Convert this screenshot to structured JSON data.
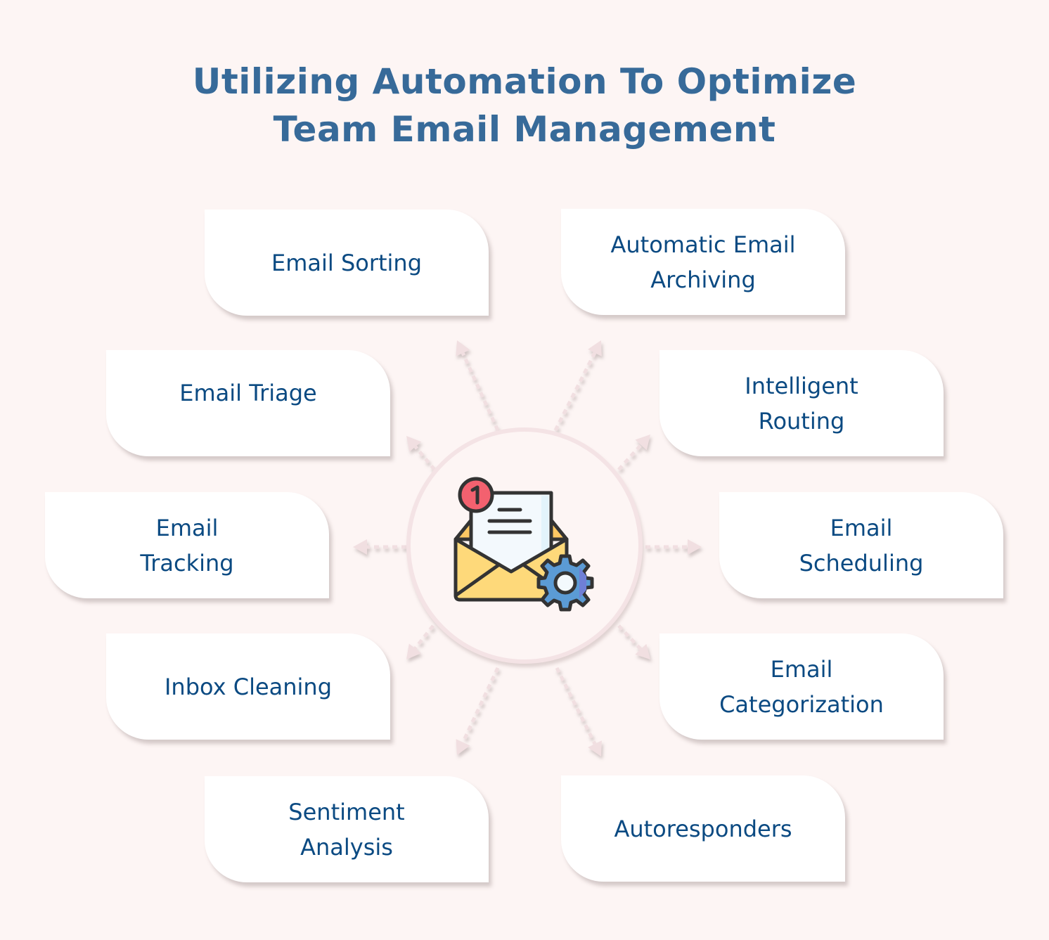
{
  "title": {
    "line1": "Utilizing Automation To Optimize",
    "line2": "Team Email Management"
  },
  "center": {
    "icon": "email-automation-icon",
    "badge_count": "1"
  },
  "colors": {
    "background": "#fdf5f4",
    "title": "#376a99",
    "card_text": "#0b4a82",
    "card_bg": "#ffffff",
    "ring": "#f4e3e5",
    "arrow": "#f1dfe1",
    "envelope": "#fed97a",
    "badge": "#f3616f",
    "gear": "#5b9bd5"
  },
  "items": [
    {
      "id": "email-sorting",
      "lines": [
        "Email Sorting"
      ]
    },
    {
      "id": "automatic-email-archiving",
      "lines": [
        "Automatic Email",
        "Archiving"
      ]
    },
    {
      "id": "email-triage",
      "lines": [
        "Email Triage"
      ]
    },
    {
      "id": "intelligent-routing",
      "lines": [
        "Intelligent",
        "Routing"
      ]
    },
    {
      "id": "email-tracking",
      "lines": [
        "Email",
        "Tracking"
      ]
    },
    {
      "id": "email-scheduling",
      "lines": [
        "Email",
        "Scheduling"
      ]
    },
    {
      "id": "inbox-cleaning",
      "lines": [
        "Inbox Cleaning"
      ]
    },
    {
      "id": "email-categorization",
      "lines": [
        "Email",
        "Categorization"
      ]
    },
    {
      "id": "sentiment-analysis",
      "lines": [
        "Sentiment",
        "Analysis"
      ]
    },
    {
      "id": "autoresponders",
      "lines": [
        "Autoresponders"
      ]
    }
  ]
}
